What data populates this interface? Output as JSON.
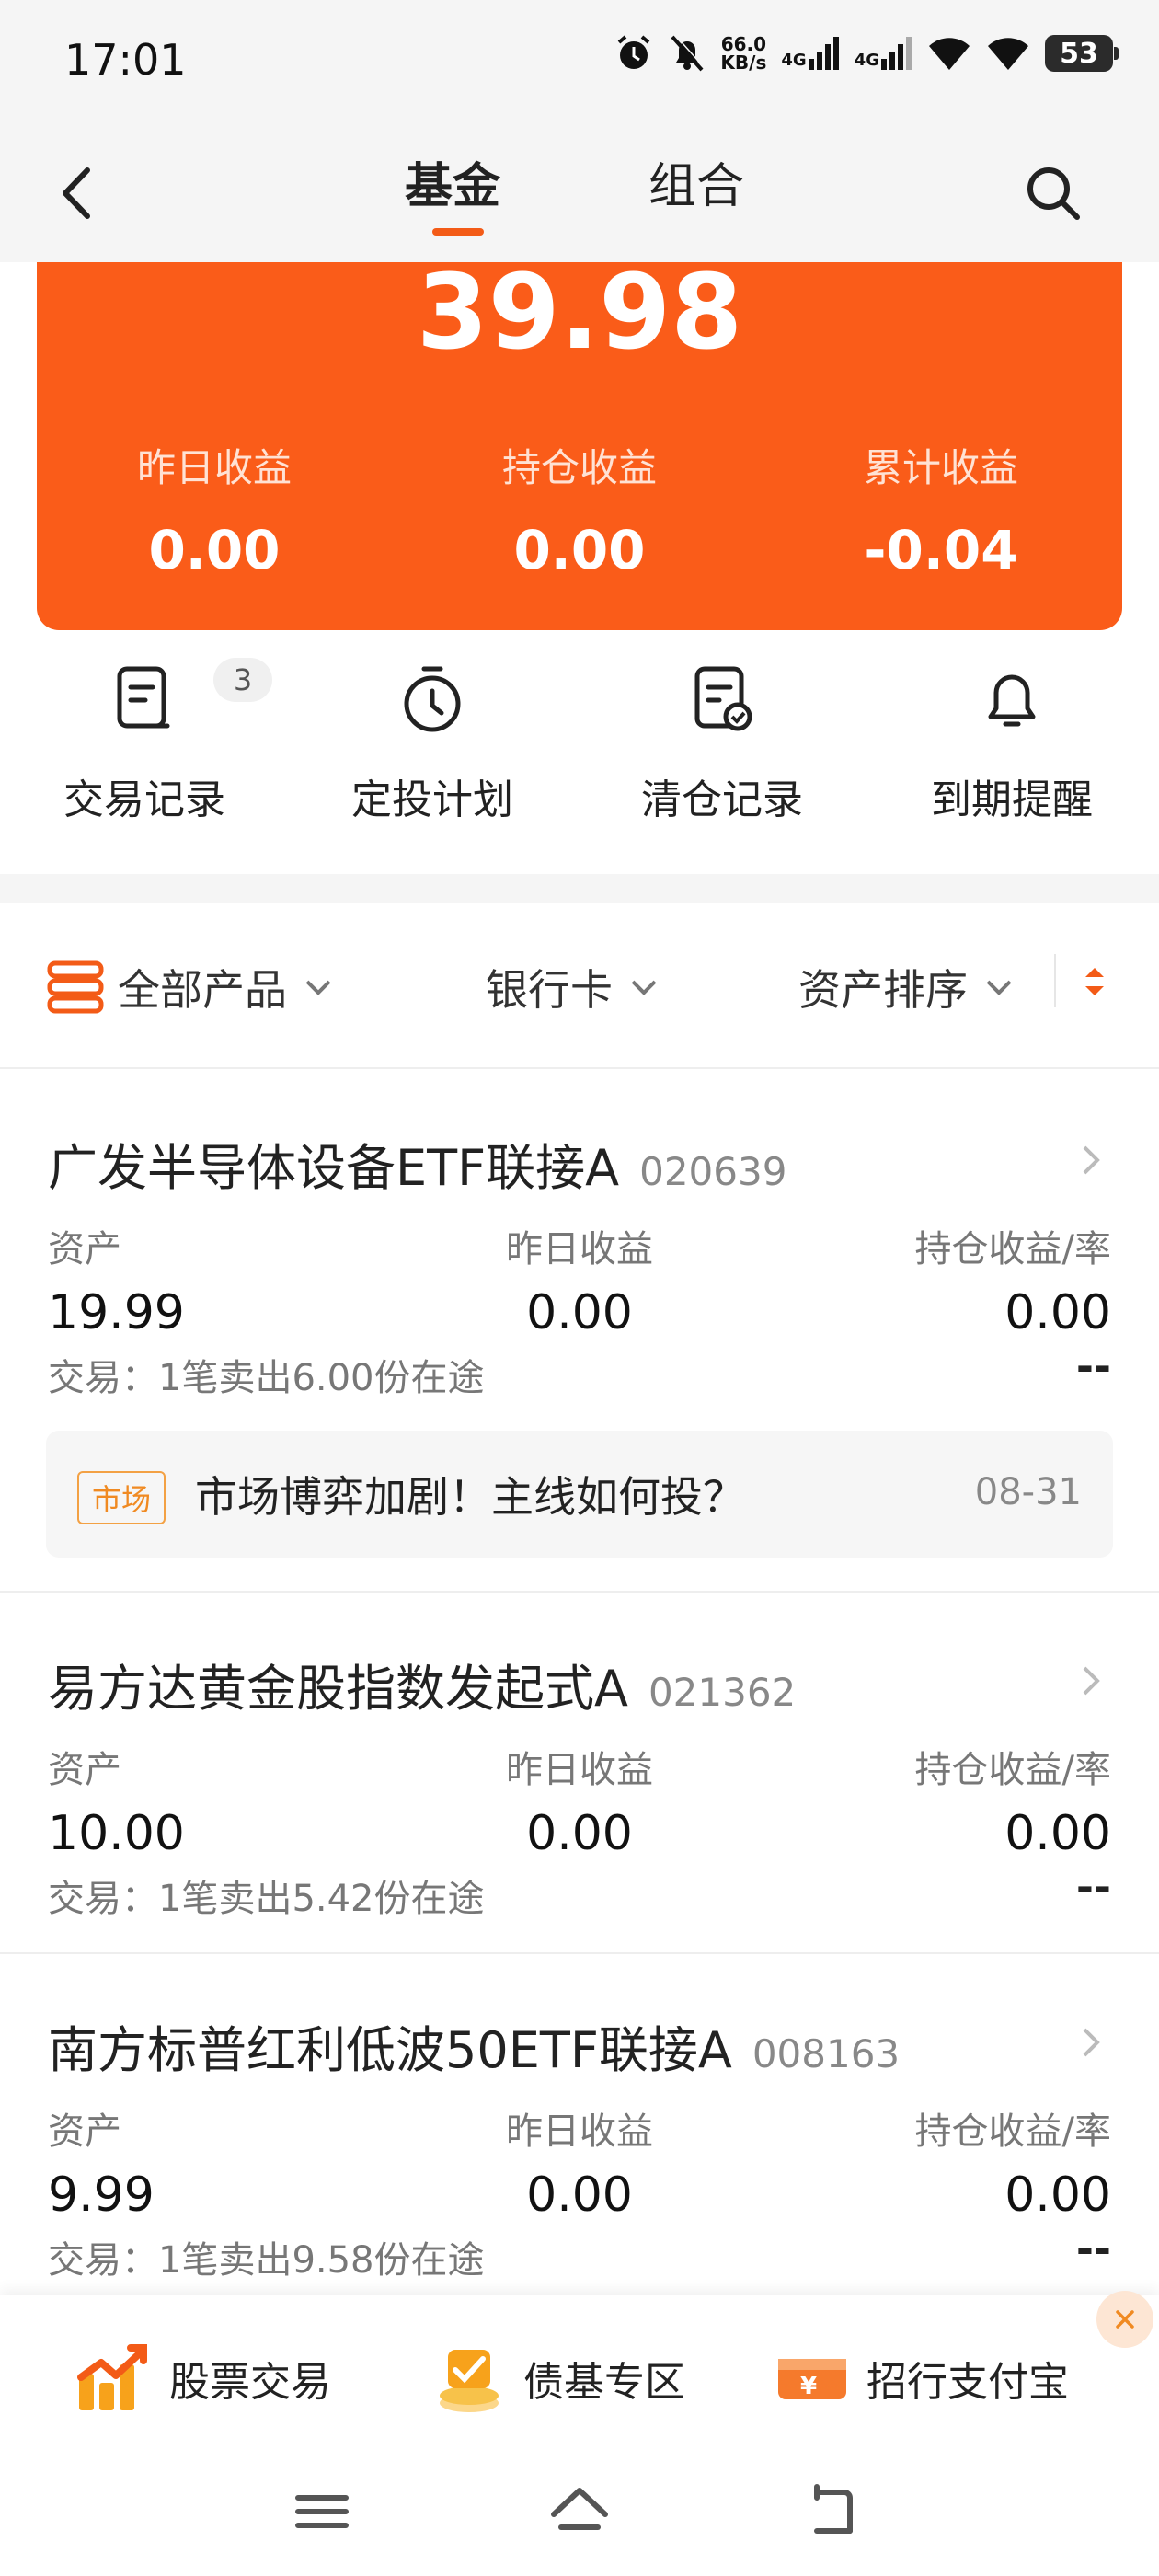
{
  "status_bar": {
    "time": "17:01",
    "net_speed_value": "66.0",
    "net_speed_unit": "KB/s",
    "network_1": "4G",
    "network_2": "4G",
    "battery": "53"
  },
  "header": {
    "tabs": [
      {
        "label": "基金",
        "active": true
      },
      {
        "label": "组合",
        "active": false
      }
    ],
    "icons": [
      "back-icon",
      "search-icon"
    ]
  },
  "summary": {
    "total": "39.98",
    "stats": [
      {
        "label": "昨日收益",
        "value": "0.00"
      },
      {
        "label": "持仓收益",
        "value": "0.00"
      },
      {
        "label": "累计收益",
        "value": "-0.04"
      }
    ],
    "color": "#fa5c19"
  },
  "quick_actions": [
    {
      "label": "交易记录",
      "icon": "document-icon",
      "badge": "3"
    },
    {
      "label": "定投计划",
      "icon": "stopwatch-icon"
    },
    {
      "label": "清仓记录",
      "icon": "document-check-icon"
    },
    {
      "label": "到期提醒",
      "icon": "bell-icon"
    }
  ],
  "filters": {
    "product": "全部产品",
    "bank_card": "银行卡",
    "sort": "资产排序"
  },
  "fund_columns": {
    "asset": "资产",
    "yesterday": "昨日收益",
    "holding": "持仓收益/率"
  },
  "funds": [
    {
      "name": "广发半导体设备ETF联接A",
      "code": "020639",
      "asset": "19.99",
      "yesterday": "0.00",
      "holding": "0.00",
      "holding_rate": "--",
      "trade": "交易：1笔卖出6.00份在途",
      "news": {
        "tag": "市场",
        "title": "市场博弈加剧！主线如何投？",
        "date": "08-31"
      }
    },
    {
      "name": "易方达黄金股指数发起式A",
      "code": "021362",
      "asset": "10.00",
      "yesterday": "0.00",
      "holding": "0.00",
      "holding_rate": "--",
      "trade": "交易：1笔卖出5.42份在途"
    },
    {
      "name": "南方标普红利低波50ETF联接A",
      "code": "008163",
      "asset": "9.99",
      "yesterday": "0.00",
      "holding": "0.00",
      "holding_rate": "--",
      "trade": "交易：1笔卖出9.58份在途"
    }
  ],
  "bottom_promos": [
    {
      "label": "股票交易",
      "icon": "stock-chart-icon"
    },
    {
      "label": "债基专区",
      "icon": "bond-fund-icon"
    },
    {
      "label": "招行支付宝",
      "icon": "yuan-card-icon"
    }
  ],
  "accent_color": "#f35b17"
}
